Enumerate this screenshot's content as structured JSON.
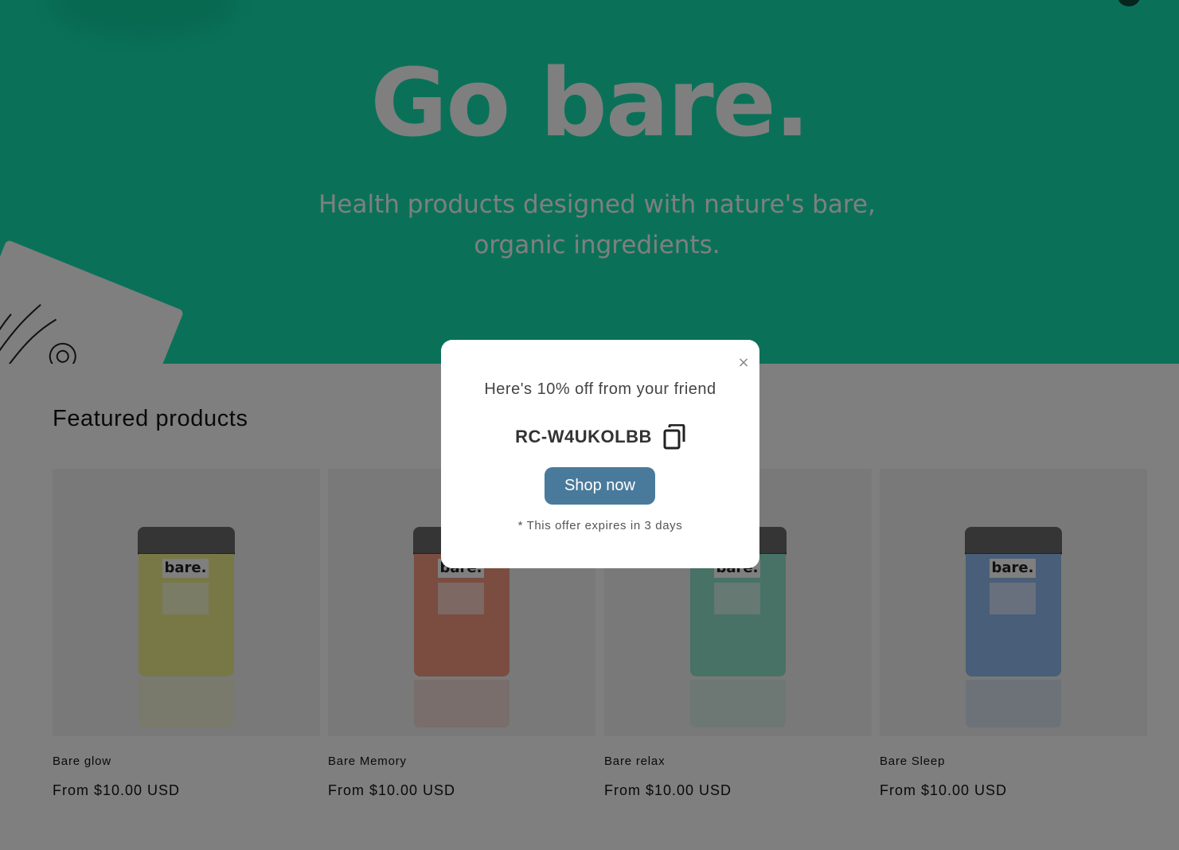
{
  "hero": {
    "title": "Go bare.",
    "subtitle_line1": "Health products designed with nature's bare,",
    "subtitle_line2": "organic ingredients.",
    "background_color": "#14e3b1"
  },
  "featured": {
    "title": "Featured products",
    "products": [
      {
        "name": "Bare glow",
        "price": "From $10.00 USD",
        "tin_label": "bare.",
        "color": "#eef08a"
      },
      {
        "name": "Bare Memory",
        "price": "From $10.00 USD",
        "tin_label": "bare.",
        "color": "#f59a80"
      },
      {
        "name": "Bare relax",
        "price": "From $10.00 USD",
        "tin_label": "bare.",
        "color": "#8fe5cb"
      },
      {
        "name": "Bare Sleep",
        "price": "From $10.00 USD",
        "tin_label": "bare.",
        "color": "#93bcf0"
      }
    ]
  },
  "popup": {
    "close_label": "×",
    "heading": "Here's 10% off from your friend",
    "code": "RC-W4UKOLBB",
    "copy_icon": "copy-icon",
    "button_label": "Shop now",
    "button_color": "#4a7a9b",
    "note": "* This offer expires in 3 days"
  }
}
